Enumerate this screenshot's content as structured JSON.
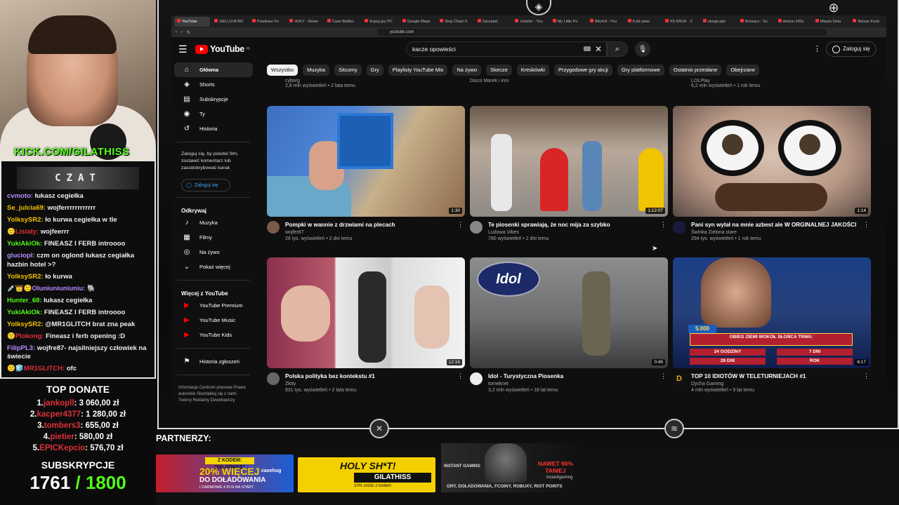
{
  "stream": {
    "kick_url": "KICK.COM/GILATHISS",
    "chat_title": "CZAT",
    "chat": [
      {
        "user": "cvmoto:",
        "text": "łukasz cegiełka",
        "color": "#b58cff"
      },
      {
        "user": "Se_julcia69:",
        "text": "wojferrrrrrrrrrrr",
        "color": "#f2c200"
      },
      {
        "user": "YolksySR2:",
        "text": "ło kurwa cegiełka w tle",
        "color": "#f2c200"
      },
      {
        "user": "🙂Lisiaty:",
        "text": "wojfeerrr",
        "color": "#e0303a"
      },
      {
        "user": "YukiAkiOk:",
        "text": "FINEASZ I FERB introooo",
        "color": "#53fc18"
      },
      {
        "user": "gluciopl:",
        "text": "czm on oglond łukasz cegiałka hazbin hotel >?",
        "color": "#b58cff"
      },
      {
        "user": "YolksySR2:",
        "text": "ło kurwa",
        "color": "#f2c200"
      },
      {
        "user": "💉👑🙂Oluniuniuniuniu:",
        "text": "🐘",
        "color": "#b58cff"
      },
      {
        "user": "Hunter_68:",
        "text": "łukasz cegiełka",
        "color": "#53fc18"
      },
      {
        "user": "YukiAkiOk:",
        "text": "FINEASZ I FERB introooo",
        "color": "#53fc18"
      },
      {
        "user": "YolksySR2:",
        "text": "@MR1GLITCH brat zna peak",
        "color": "#f2c200"
      },
      {
        "user": "🙂Plokong:",
        "text": "Fineasz i ferb opening :D",
        "color": "#e0303a"
      },
      {
        "user": "FilipPL3:",
        "text": "wojfre87- najsilniejszy człowiek na świecie",
        "color": "#b58cff"
      },
      {
        "user": "🙂🧊MR1GLITCH:",
        "text": "ofc",
        "color": "#e0303a"
      }
    ],
    "top_donate_title": "TOP DONATE",
    "donations": [
      {
        "rank": "1.",
        "name": "jankopll",
        "amount": ": 3 060,00 zł"
      },
      {
        "rank": "2.",
        "name": "kacper4377",
        "amount": ": 1 280,00 zł"
      },
      {
        "rank": "3.",
        "name": "tombers3",
        "amount": ": 655,00 zł"
      },
      {
        "rank": "4.",
        "name": "pietier",
        "amount": ": 580,00 zł"
      },
      {
        "rank": "5.",
        "name": "EPICKepcio",
        "amount": ": 576,70 zł"
      }
    ],
    "subs_title": "SUBSKRYPCJE",
    "subs_count": "1761",
    "subs_goal": "/ 1800",
    "partners_label": "PARTNERZY:",
    "ads": {
      "ad1_badge": "Z KODEM: \"GILATHISS\"",
      "ad1_line1": "20% WIĘCEJ",
      "ad1_line2": "DO DOŁADOWANIA",
      "ad1_line3": "I DARMOWE 4 PLN NA START",
      "ad1_brand": "casehug",
      "ad2_line1": "HOLY SH*T!",
      "ad2_line2": "GILATHISS",
      "ad2_line3": "10% zniżki z kodem",
      "ad3_line1": "NAWET 90% TANIEJ",
      "ad3_line2": "INSTANT GAMING",
      "ad3_line3": "GRY, DOŁADOWANIA, FCOINY, ROBUXY, RIOT POINTS",
      "ad3_line4": "instantgaming"
    }
  },
  "browser": {
    "tabs": [
      "YouTube",
      "HELLUVA BO",
      "Powiłowe Fo",
      "HOLY - Rewe",
      "Case Bottles",
      "Kupuj gry PC",
      "Google Maps",
      "Stop Cham F",
      "Zaczęłaś",
      "xSmiler - You",
      "My Little Po",
      "BilizKA - You",
      "8 pik piwe",
      "K5 KRUK - C",
      "obraja płyt",
      "Bureacz - Su",
      "detson 240s",
      "Miasto Deta",
      "Nissan Festi"
    ],
    "url": "youtube.com"
  },
  "youtube": {
    "logo_text": "YouTube",
    "region": "PL",
    "search_value": "kacze opowieści",
    "signin_label": "Zaloguj się",
    "sidebar": {
      "main": [
        {
          "label": "Główna",
          "icon": "home-icon"
        },
        {
          "label": "Shorts",
          "icon": "shorts-icon"
        },
        {
          "label": "Subskrypcje",
          "icon": "subscriptions-icon"
        },
        {
          "label": "Ty",
          "icon": "you-icon"
        },
        {
          "label": "Historia",
          "icon": "history-icon"
        }
      ],
      "signin_note": "Zaloguj się, by polubić film, zostawić komentarz lub zasubskrybować kanał.",
      "signin_button": "Zaloguj się",
      "explore_title": "Odkrywaj",
      "explore": [
        {
          "label": "Muzyka",
          "icon": "music-icon"
        },
        {
          "label": "Filmy",
          "icon": "film-icon"
        },
        {
          "label": "Na żywo",
          "icon": "live-icon"
        },
        {
          "label": "Pokaż więcej",
          "icon": "chevron-down-icon"
        }
      ],
      "more_title": "Więcej z YouTube",
      "more": [
        {
          "label": "YouTube Premium"
        },
        {
          "label": "YouTube Music"
        },
        {
          "label": "YouTube Kids"
        }
      ],
      "report_history": "Historia zgłoszeń",
      "footer": "Informacje  Centrum prasowe  Prawa autorskie  Skontaktuj się z nami  Twórcy  Reklamy  Deweloperzy"
    },
    "chips": [
      "Wszystko",
      "Muzyka",
      "Sitcomy",
      "Gry",
      "Playlisty YouTube Mix",
      "Na żywo",
      "Skecze",
      "Kreskówki",
      "Przygodowe gry akcji",
      "Gry platformowe",
      "Ostatnio przesłane",
      "Obejrzane"
    ],
    "top_row_meta": [
      {
        "channel": "cyborg",
        "meta": "2,8 mln wyświetleń • 2 lata temu"
      },
      {
        "channel": "Disco Marek i inni",
        "meta": ""
      },
      {
        "channel": "LOLPlay",
        "meta": "6,2 mln wyświetleń • 1 rok temu"
      }
    ],
    "videos": [
      {
        "title": "Pompki w wannie z drzwiami na plecach",
        "channel": "wojfer87",
        "meta": "26 tys. wyświetleń • 2 dni temu",
        "duration": "1:30"
      },
      {
        "title": "Te piosenki sprawiają, że noc mija za szybko",
        "channel": "Ludowa Vibes",
        "meta": "780 wyświetleń • 2 dni temu",
        "duration": "1:12:07"
      },
      {
        "title": "Pani syn wylał na mnie azbest ale W ORGINALNEJ JAKOŚCI",
        "channel": "Świnka Zielona stare",
        "meta": "294 tys. wyświetleń • 1 rok temu",
        "duration": "1:14"
      },
      {
        "title": "Polska polityka bez kontekstu   #1",
        "channel": "Złoty",
        "meta": "931 tys. wyświetleń • 2 lata temu",
        "duration": "12:16"
      },
      {
        "title": "Idol - Turystyczna Piosenka",
        "channel": "tomeknet",
        "meta": "3,2 mln wyświetleń • 18 lat temu",
        "duration": "0:45"
      },
      {
        "title": "TOP 10 IDIOTÓW W TELETURNIEJACH #1",
        "channel": "Dycha Gaming",
        "meta": "4 mln wyświetleń • 9 lat temu",
        "duration": "6:17"
      }
    ],
    "thumb_texts": {
      "idol": "Idol",
      "quiz_question": "OBIEG ZIEMI WOKÓŁ SŁOŃCA TRWA:",
      "quiz_a": "24 GODZINY",
      "quiz_b": "7 DNI",
      "quiz_c": "28 DNI",
      "quiz_d": "ROK",
      "quiz_amount": "5.000"
    }
  }
}
